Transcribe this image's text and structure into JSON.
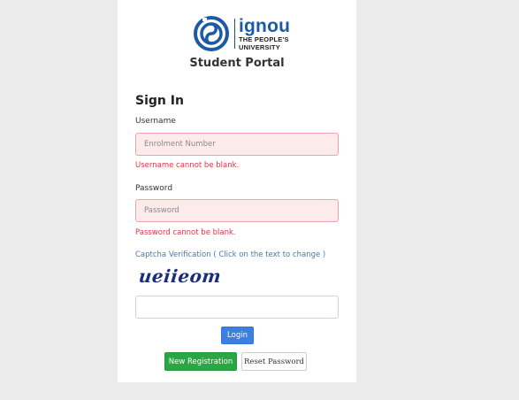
{
  "branding": {
    "logo_icon": "ignou-swirl-icon",
    "name": "ignou",
    "tagline_line1": "THE PEOPLE'S",
    "tagline_line2": "UNIVERSITY",
    "portal_title": "Student Portal",
    "brand_color": "#1d5aa6"
  },
  "form": {
    "heading": "Sign In",
    "username": {
      "label": "Username",
      "placeholder": "Enrolment Number",
      "value": "",
      "error": "Username cannot be blank."
    },
    "password": {
      "label": "Password",
      "placeholder": "Password",
      "value": "",
      "error": "Password cannot be blank."
    },
    "captcha": {
      "link_text": "Captcha Verification ( Click on the text to change )",
      "text": "ueiieom",
      "value": ""
    },
    "buttons": {
      "login": "Login",
      "new_registration": "New Registration",
      "reset_password": "Reset Password"
    }
  },
  "colors": {
    "error": "#dc3545",
    "primary": "#3b7fe3",
    "success": "#28a745"
  }
}
